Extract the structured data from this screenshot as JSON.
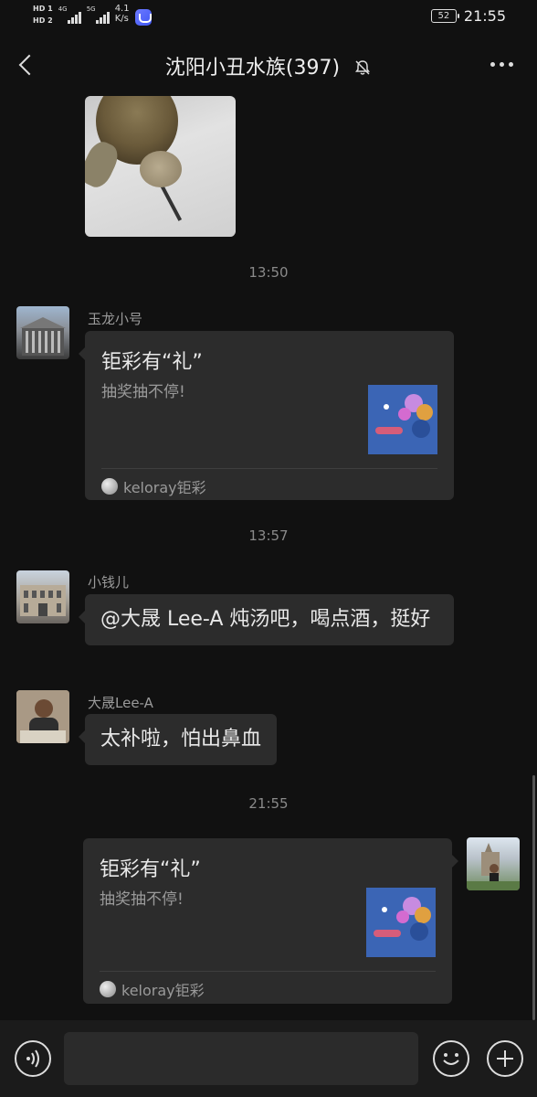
{
  "status_bar": {
    "hd1": "HD 1",
    "hd2": "HD 2",
    "net1": "4G",
    "net2": "5G",
    "speed_value": "4.1",
    "speed_unit": "K/s",
    "battery": "52",
    "time": "21:55"
  },
  "header": {
    "title": "沈阳小丑水族(397)",
    "mute_icon": "bell-off-icon",
    "more_icon": "more-dots-icon"
  },
  "messages": {
    "time1": "13:50",
    "m1": {
      "sender": "玉龙小号",
      "card_title": "钜彩有“礼”",
      "card_desc": "抽奖抽不停!",
      "card_source": "keloray钜彩"
    },
    "time2": "13:57",
    "m2": {
      "sender": "小钱儿",
      "text": "@大晟 Lee-A 炖汤吧，喝点酒，挺好"
    },
    "m3": {
      "sender": "大晟Lee-A",
      "text": "太补啦，怕出鼻血"
    },
    "time3": "21:55",
    "m4": {
      "card_title": "钜彩有“礼”",
      "card_desc": "抽奖抽不停!",
      "card_source": "keloray钜彩"
    }
  },
  "input_bar": {
    "placeholder": "",
    "voice_icon": "voice-icon",
    "emoji_icon": "emoji-icon",
    "plus_icon": "plus-icon"
  }
}
